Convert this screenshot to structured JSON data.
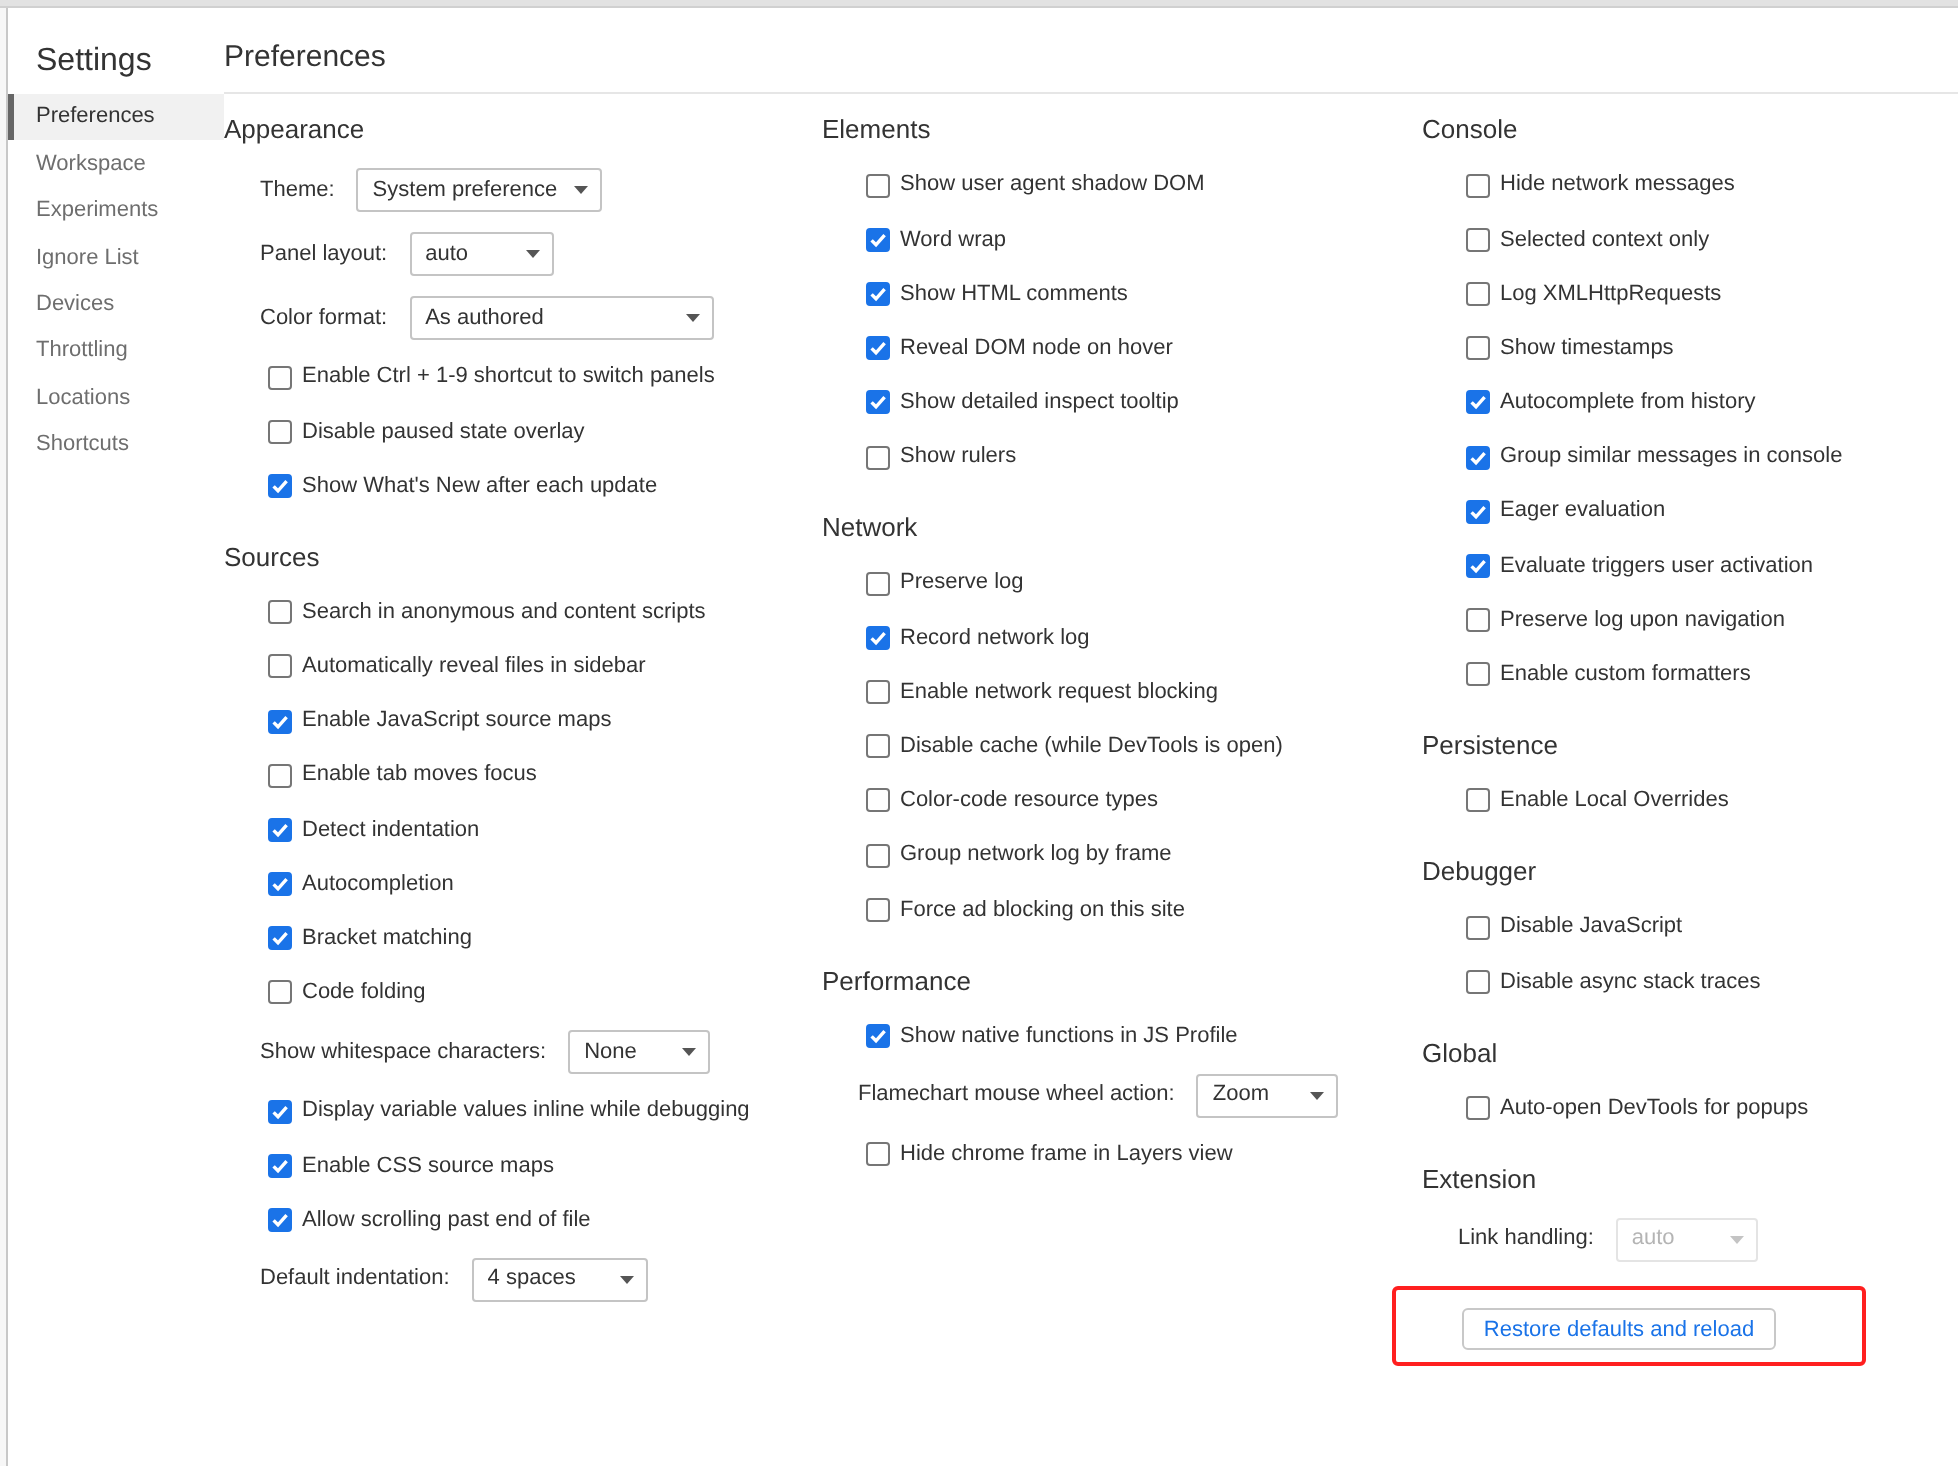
{
  "sidebar": {
    "title": "Settings",
    "items": [
      {
        "label": "Preferences",
        "selected": true
      },
      {
        "label": "Workspace",
        "selected": false
      },
      {
        "label": "Experiments",
        "selected": false
      },
      {
        "label": "Ignore List",
        "selected": false
      },
      {
        "label": "Devices",
        "selected": false
      },
      {
        "label": "Throttling",
        "selected": false
      },
      {
        "label": "Locations",
        "selected": false
      },
      {
        "label": "Shortcuts",
        "selected": false
      }
    ]
  },
  "page": {
    "title": "Preferences"
  },
  "columns": [
    {
      "sections": [
        {
          "title": "Appearance",
          "rows": [
            {
              "kind": "select",
              "label": "Theme:",
              "value": "System preference",
              "disabled": false
            },
            {
              "kind": "select",
              "label": "Panel layout:",
              "value": "auto",
              "disabled": false
            },
            {
              "kind": "select",
              "label": "Color format:",
              "value": "As authored",
              "disabled": false
            },
            {
              "kind": "checkbox",
              "label": "Enable Ctrl + 1-9 shortcut to switch panels",
              "checked": false
            },
            {
              "kind": "checkbox",
              "label": "Disable paused state overlay",
              "checked": false
            },
            {
              "kind": "checkbox",
              "label": "Show What's New after each update",
              "checked": true
            }
          ]
        },
        {
          "title": "Sources",
          "rows": [
            {
              "kind": "checkbox",
              "label": "Search in anonymous and content scripts",
              "checked": false
            },
            {
              "kind": "checkbox",
              "label": "Automatically reveal files in sidebar",
              "checked": false
            },
            {
              "kind": "checkbox",
              "label": "Enable JavaScript source maps",
              "checked": true
            },
            {
              "kind": "checkbox",
              "label": "Enable tab moves focus",
              "checked": false
            },
            {
              "kind": "checkbox",
              "label": "Detect indentation",
              "checked": true
            },
            {
              "kind": "checkbox",
              "label": "Autocompletion",
              "checked": true
            },
            {
              "kind": "checkbox",
              "label": "Bracket matching",
              "checked": true
            },
            {
              "kind": "checkbox",
              "label": "Code folding",
              "checked": false
            },
            {
              "kind": "select",
              "label": "Show whitespace characters:",
              "value": "None",
              "disabled": false
            },
            {
              "kind": "checkbox",
              "label": "Display variable values inline while debugging",
              "checked": true
            },
            {
              "kind": "checkbox",
              "label": "Enable CSS source maps",
              "checked": true
            },
            {
              "kind": "checkbox",
              "label": "Allow scrolling past end of file",
              "checked": true
            },
            {
              "kind": "select",
              "label": "Default indentation:",
              "value": "4 spaces",
              "disabled": false
            }
          ]
        }
      ]
    },
    {
      "sections": [
        {
          "title": "Elements",
          "rows": [
            {
              "kind": "checkbox",
              "label": "Show user agent shadow DOM",
              "checked": false
            },
            {
              "kind": "checkbox",
              "label": "Word wrap",
              "checked": true
            },
            {
              "kind": "checkbox",
              "label": "Show HTML comments",
              "checked": true
            },
            {
              "kind": "checkbox",
              "label": "Reveal DOM node on hover",
              "checked": true
            },
            {
              "kind": "checkbox",
              "label": "Show detailed inspect tooltip",
              "checked": true
            },
            {
              "kind": "checkbox",
              "label": "Show rulers",
              "checked": false
            }
          ]
        },
        {
          "title": "Network",
          "rows": [
            {
              "kind": "checkbox",
              "label": "Preserve log",
              "checked": false
            },
            {
              "kind": "checkbox",
              "label": "Record network log",
              "checked": true
            },
            {
              "kind": "checkbox",
              "label": "Enable network request blocking",
              "checked": false
            },
            {
              "kind": "checkbox",
              "label": "Disable cache (while DevTools is open)",
              "checked": false
            },
            {
              "kind": "checkbox",
              "label": "Color-code resource types",
              "checked": false
            },
            {
              "kind": "checkbox",
              "label": "Group network log by frame",
              "checked": false
            },
            {
              "kind": "checkbox",
              "label": "Force ad blocking on this site",
              "checked": false
            }
          ]
        },
        {
          "title": "Performance",
          "rows": [
            {
              "kind": "checkbox",
              "label": "Show native functions in JS Profile",
              "checked": true
            },
            {
              "kind": "select",
              "label": "Flamechart mouse wheel action:",
              "value": "Zoom",
              "disabled": false
            },
            {
              "kind": "checkbox",
              "label": "Hide chrome frame in Layers view",
              "checked": false
            }
          ]
        }
      ]
    },
    {
      "sections": [
        {
          "title": "Console",
          "rows": [
            {
              "kind": "checkbox",
              "label": "Hide network messages",
              "checked": false
            },
            {
              "kind": "checkbox",
              "label": "Selected context only",
              "checked": false
            },
            {
              "kind": "checkbox",
              "label": "Log XMLHttpRequests",
              "checked": false
            },
            {
              "kind": "checkbox",
              "label": "Show timestamps",
              "checked": false
            },
            {
              "kind": "checkbox",
              "label": "Autocomplete from history",
              "checked": true
            },
            {
              "kind": "checkbox",
              "label": "Group similar messages in console",
              "checked": true
            },
            {
              "kind": "checkbox",
              "label": "Eager evaluation",
              "checked": true
            },
            {
              "kind": "checkbox",
              "label": "Evaluate triggers user activation",
              "checked": true
            },
            {
              "kind": "checkbox",
              "label": "Preserve log upon navigation",
              "checked": false
            },
            {
              "kind": "checkbox",
              "label": "Enable custom formatters",
              "checked": false
            }
          ]
        },
        {
          "title": "Persistence",
          "rows": [
            {
              "kind": "checkbox",
              "label": "Enable Local Overrides",
              "checked": false
            }
          ]
        },
        {
          "title": "Debugger",
          "rows": [
            {
              "kind": "checkbox",
              "label": "Disable JavaScript",
              "checked": false
            },
            {
              "kind": "checkbox",
              "label": "Disable async stack traces",
              "checked": false
            }
          ]
        },
        {
          "title": "Global",
          "rows": [
            {
              "kind": "checkbox",
              "label": "Auto-open DevTools for popups",
              "checked": false
            }
          ]
        },
        {
          "title": "Extension",
          "rows": [
            {
              "kind": "select",
              "label": "Link handling:",
              "value": "auto",
              "disabled": true
            }
          ]
        }
      ]
    }
  ],
  "restore_button": {
    "label": "Restore defaults and reload",
    "highlighted": true
  }
}
